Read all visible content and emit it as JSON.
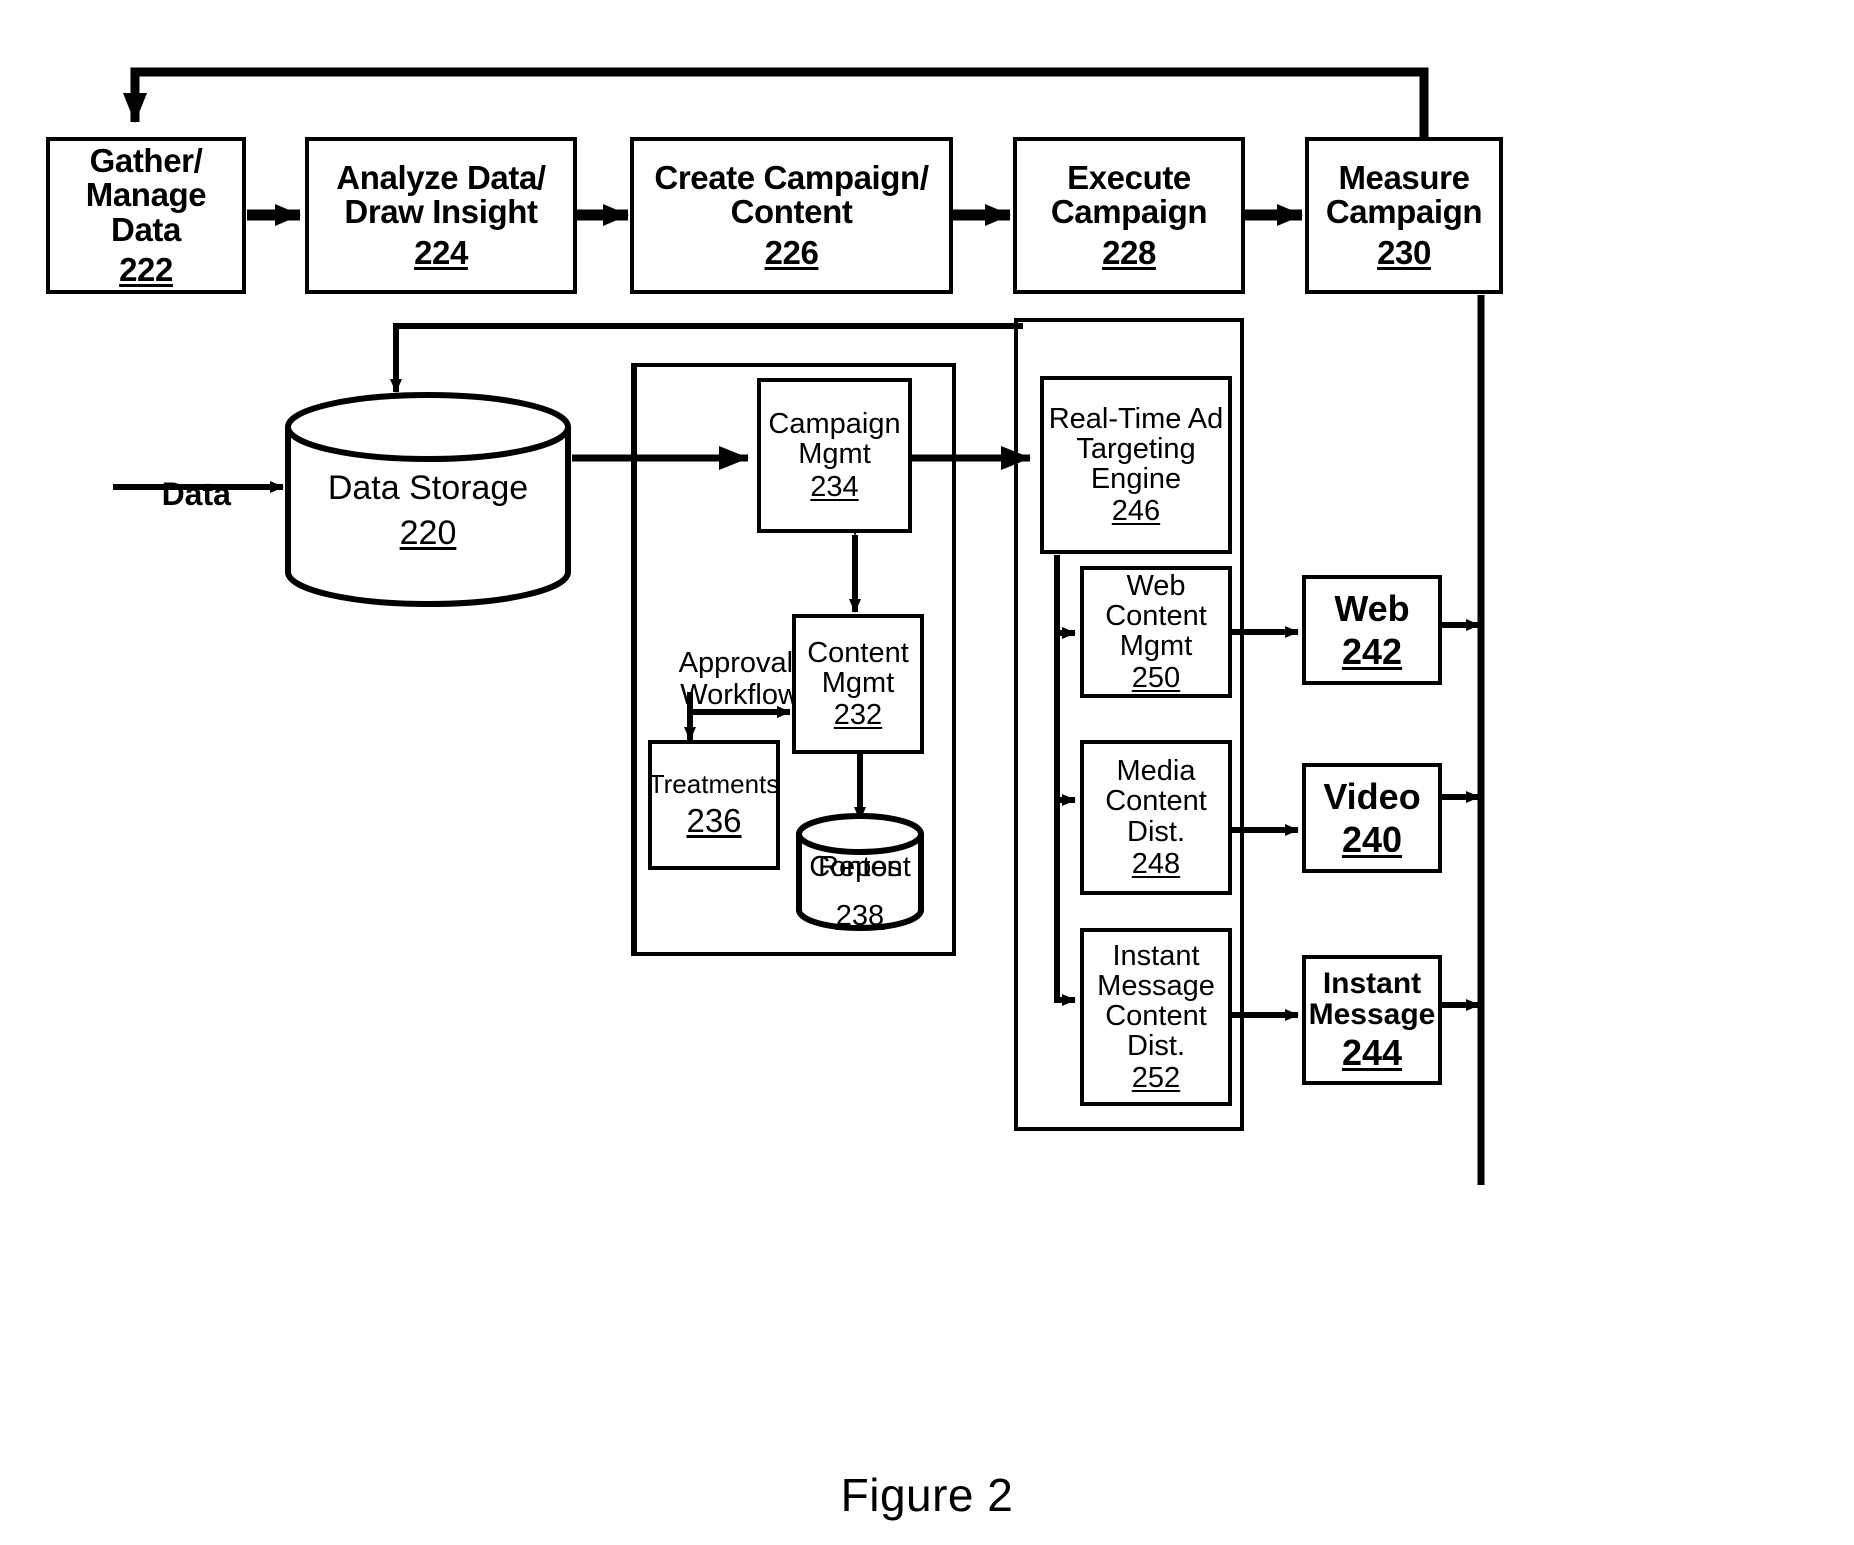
{
  "figure": {
    "caption": "Figure 2"
  },
  "labels": {
    "data_input": "Data",
    "approval_workflow_l1": "Approval",
    "approval_workflow_l2": "Workflow"
  },
  "process_flow": [
    {
      "id": "gather-manage-data",
      "lines": [
        "Gather/",
        "Manage",
        "Data"
      ],
      "ref": "222"
    },
    {
      "id": "analyze-data-draw-insight",
      "lines": [
        "Analyze Data/",
        "Draw Insight"
      ],
      "ref": "224"
    },
    {
      "id": "create-campaign-content",
      "lines": [
        "Create Campaign/",
        "Content"
      ],
      "ref": "226"
    },
    {
      "id": "execute-campaign",
      "lines": [
        "Execute",
        "Campaign"
      ],
      "ref": "228"
    },
    {
      "id": "measure-campaign",
      "lines": [
        "Measure",
        "Campaign"
      ],
      "ref": "230"
    }
  ],
  "components": {
    "data_storage": {
      "lines": [
        "Data Storage"
      ],
      "ref": "220"
    },
    "campaign_mgmt": {
      "lines": [
        "Campaign",
        "Mgmt"
      ],
      "ref": "234"
    },
    "content_mgmt": {
      "lines": [
        "Content",
        "Mgmt"
      ],
      "ref": "232"
    },
    "treatments": {
      "lines": [
        "Treatments"
      ],
      "ref": "236"
    },
    "content_repository": {
      "lines": [
        "Content",
        "Repos"
      ],
      "ref": "238"
    },
    "realtime_ad_targeting_engine": {
      "lines": [
        "Real-Time Ad",
        "Targeting",
        "Engine"
      ],
      "ref": "246"
    },
    "web_content_mgmt": {
      "lines": [
        "Web",
        "Content",
        "Mgmt"
      ],
      "ref": "250"
    },
    "media_content_dist": {
      "lines": [
        "Media",
        "Content",
        "Dist."
      ],
      "ref": "248"
    },
    "instant_message_content_dist": {
      "lines": [
        "Instant",
        "Message",
        "Content",
        "Dist."
      ],
      "ref": "252"
    }
  },
  "channels": {
    "web": {
      "lines": [
        "Web"
      ],
      "ref": "242"
    },
    "video": {
      "lines": [
        "Video"
      ],
      "ref": "240"
    },
    "instant_message": {
      "lines": [
        "Instant",
        "Message"
      ],
      "ref": "244"
    }
  },
  "colors": {
    "stroke": "#000000",
    "background": "#ffffff"
  }
}
